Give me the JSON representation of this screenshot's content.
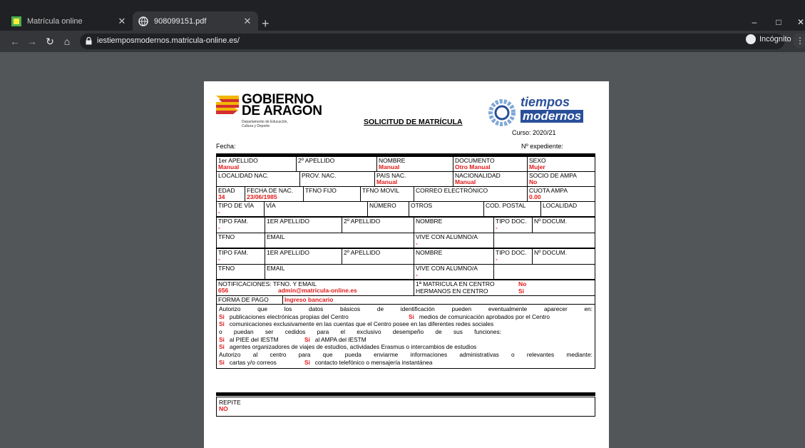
{
  "browser": {
    "tabs": [
      {
        "title": "Matrícula online",
        "active": false
      },
      {
        "title": "908099151.pdf",
        "active": true
      }
    ],
    "new_tab": "+",
    "url": "iestiemposmodernos.matricula-online.es/",
    "profile_label": "Incógnito",
    "window_controls": {
      "minimize": "–",
      "maximize": "□",
      "close": "✕"
    },
    "icons": [
      "back-icon",
      "forward-icon",
      "reload-icon",
      "home-icon",
      "lock-icon",
      "star-icon",
      "incognito-icon",
      "menu-icon"
    ]
  },
  "document": {
    "logo_left": {
      "title_line1": "GOBIERNO",
      "title_line2": "DE ARAGON",
      "sub_line1": "Departamento de Educación,",
      "sub_line2": "Cultura y Deporte"
    },
    "title": "SOLICITUD DE MATRÍCULA",
    "logo_right": {
      "word1": "tiempos",
      "word2": "modernos"
    },
    "curso": "Curso: 2020/21",
    "fecha_label": "Fecha:",
    "expediente_label": "Nº expediente:",
    "student": {
      "apellido1_label": "1er APELLIDO",
      "apellido1": "Manual",
      "apellido2_label": "2º APELLIDO",
      "apellido2": "",
      "nombre_label": "NOMBRE",
      "nombre": "Manual",
      "documento_label": "DOCUMENTO",
      "documento": "Otro Manual",
      "sexo_label": "SEXO",
      "sexo": "Mujer",
      "localidad_label": "LOCALIDAD NAC.",
      "provincia_label": "PROV. NAC.",
      "pais_label": "PAIS NAC.",
      "pais": "Manual",
      "nacionalidad_label": "NACIONALIDAD",
      "nacionalidad": "Manual",
      "socio_label": "SOCIO DE AMPA",
      "socio": "No",
      "edad_label": "EDAD",
      "edad": "34",
      "fnac_label": "FECHA DE NAC.",
      "fnac": "23/06/1985",
      "tfijo_label": "TFNO FIJO",
      "tmovil_label": "TFNO MOVIL",
      "email_label": "CORREO ELECTRÓNICO",
      "cuota_label": "CUOTA AMPA",
      "cuota": "0.00",
      "tipovia_label": "TIPO DE VÍA",
      "tipovia": "-",
      "via_label": "VÍA",
      "numero_label": "NÚMERO",
      "otros_label": "OTROS",
      "cp_label": "COD. POSTAL",
      "localidad2_label": "LOCALIDAD"
    },
    "family": [
      {
        "tipo_label": "TIPO FAM.",
        "tipo": "-",
        "ap1_label": "1ER APELLIDO",
        "ap2_label": "2º APELLIDO",
        "nombre_label": "NOMBRE",
        "tipodoc_label": "TIPO DOC.",
        "tipodoc": "-",
        "ndoc_label": "Nº DOCUM.",
        "tfno_label": "TFNO",
        "email_label": "EMAIL",
        "vive_label": "VIVE CON ALUMNO/A",
        "vive": "-"
      },
      {
        "tipo_label": "TIPO FAM.",
        "tipo": "-",
        "ap1_label": "1ER APELLIDO",
        "ap2_label": "2º APELLIDO",
        "nombre_label": "NOMBRE",
        "tipodoc_label": "TIPO DOC.",
        "tipodoc": "-",
        "ndoc_label": "Nº DOCUM.",
        "tfno_label": "TFNO",
        "email_label": "EMAIL",
        "vive_label": "VIVE CON ALUMNO/A",
        "vive": "-"
      }
    ],
    "notif_label": "NOTIFICACIONES: TFNO. Y EMAIL",
    "notif_tfno": "656",
    "notif_email": "admin@matricula-online.es",
    "primera_matricula_label": "1ª MATRICULA EN CENTRO",
    "primera_matricula": "No",
    "hermanos_label": "HERMANOS EN CENTRO",
    "hermanos": "Si",
    "pago_label": "FORMA DE PAGO",
    "pago": "Ingreso bancario",
    "consent": {
      "intro": [
        "Autorizo",
        "que",
        "los",
        "datos",
        "básicos",
        "de",
        "identificación",
        "pueden",
        "eventualmente",
        "aparecer",
        "en:"
      ],
      "pub_si": "Si",
      "pub": "publicaciones electrónicas propias del Centro",
      "medios_si": "Si",
      "medios": "medios de comunicación aprobados por el Centro",
      "redes_si": "Si",
      "redes": "comunicaciones exclusivamente en las cuentas que el Centro posee en las diferentes redes sociales",
      "cedidos": [
        "o",
        "puedan",
        "ser",
        "cedidos",
        "para",
        "el",
        "exclusivo",
        "desempeño",
        "de",
        "sus",
        "funciones:"
      ],
      "piee_si": "Si",
      "piee": "al PIEE del IESTM",
      "ampa_si": "Si",
      "ampa": "al AMPA del IESTM",
      "viajes_si": "Si",
      "viajes": "agentes organizadores de viajes de estudios, actividades Erasmus o intercambios de estudios",
      "autorizo": [
        "Autorizo",
        "al",
        "centro",
        "para",
        "que",
        "pueda",
        "enviarme",
        "informaciones",
        "administrativas",
        "o",
        "relevantes",
        "mediante:"
      ],
      "cartas_si": "Si",
      "cartas": "cartas y/o correos",
      "contacto_si": "Si",
      "contacto": "contacto telefónico o mensajería instantánea"
    },
    "repite_label": "REPITE",
    "repite": "NO"
  }
}
